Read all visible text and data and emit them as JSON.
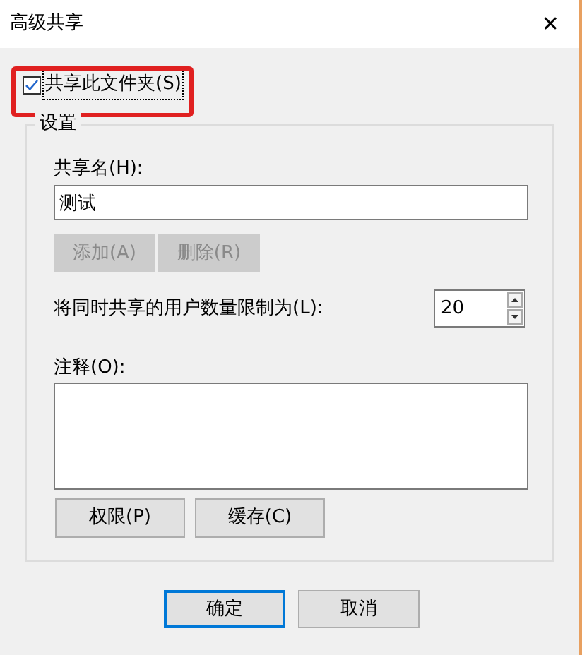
{
  "window": {
    "title": "高级共享",
    "close": "✕"
  },
  "share_checkbox": {
    "label": "共享此文件夹(S)",
    "checked": true,
    "focused": true
  },
  "settings": {
    "title": "设置",
    "share_name": {
      "label": "共享名(H):",
      "value": "测试"
    },
    "name_buttons": [
      {
        "label": "添加(A)",
        "disabled": true
      },
      {
        "label": "删除(R)",
        "disabled": true
      }
    ],
    "user_limit": {
      "label": "将同时共享的用户数量限制为(L):",
      "value": "20"
    },
    "comment": {
      "label": "注释(O):"
    },
    "buttons": [
      {
        "label": "权限(P)",
        "disabled": false
      },
      {
        "label": "缓存(C)",
        "disabled": false
      }
    ]
  },
  "footer_buttons": [
    {
      "label": "确定",
      "default": true
    },
    {
      "label": "取消",
      "default": false
    }
  ]
}
